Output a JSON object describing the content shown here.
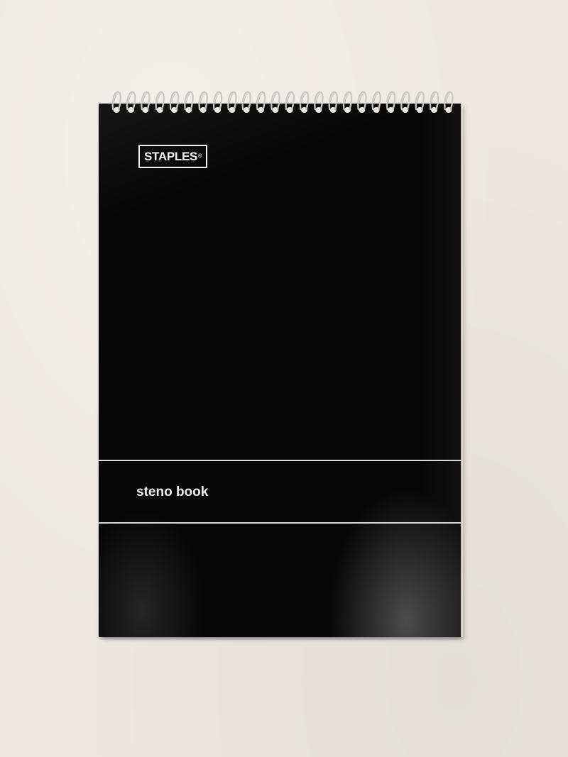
{
  "notebook": {
    "brand": "STAPLES",
    "trademark": "®",
    "title": "steno book"
  },
  "colors": {
    "background": "#ece8df",
    "cover": "#070707",
    "cover_text": "#eeeeee",
    "pages": "#f4f1ea",
    "wire": "#c9c9c9"
  }
}
